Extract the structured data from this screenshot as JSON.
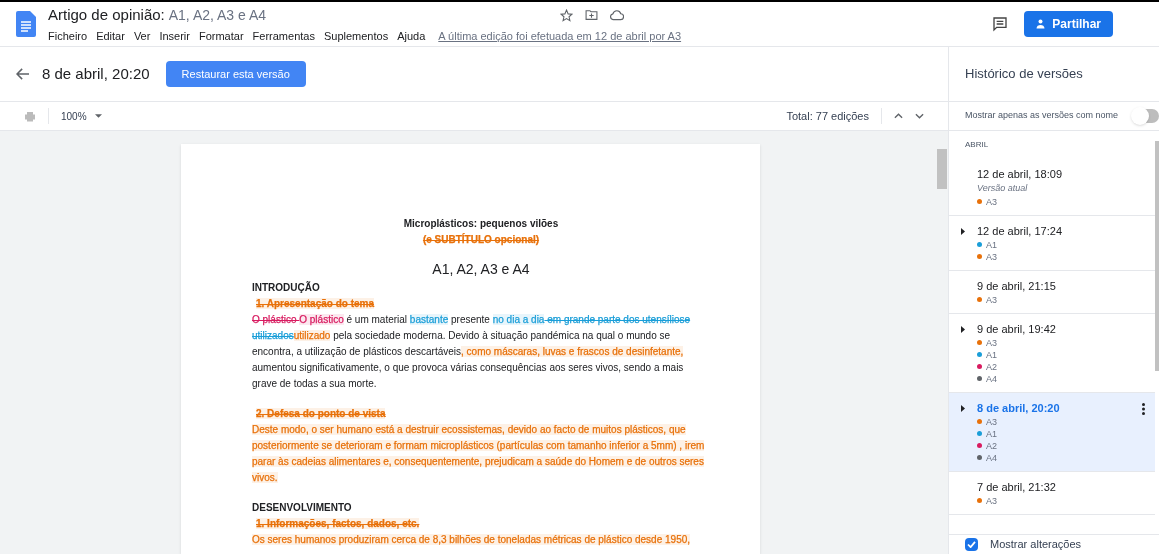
{
  "header": {
    "title": "Artigo de opinião:",
    "title_suffix": "A1, A2, A3  e A4",
    "menu": [
      "Ficheiro",
      "Editar",
      "Ver",
      "Inserir",
      "Formatar",
      "Ferramentas",
      "Suplementos",
      "Ajuda"
    ],
    "last_edit": "A última edição foi efetuada em 12 de abril por A3",
    "share_button": "Partilhar"
  },
  "version_bar": {
    "version": "8 de abril, 20:20",
    "restore_button": "Restaurar esta versão"
  },
  "toolbar": {
    "zoom": "100%",
    "total": "Total: 77 edições"
  },
  "document": {
    "blocks": [
      {
        "kind": "title",
        "segments": [
          {
            "text": "Microplásticos: pequenos vilões",
            "kind": "plain"
          }
        ]
      },
      {
        "kind": "subtitle",
        "segments": [
          {
            "text": "(e SUBTÍTULO opcional)",
            "kind": "delete",
            "color": "#e8710a"
          }
        ]
      },
      {
        "kind": "authors",
        "segments": [
          {
            "text": "A1, A2, A3 e A4",
            "kind": "plain"
          }
        ]
      },
      {
        "kind": "heading",
        "segments": [
          {
            "text": "INTRODUÇÃO",
            "kind": "plain"
          }
        ]
      },
      {
        "kind": "item",
        "segments": [
          {
            "text": "1.   Apresentação do tema",
            "kind": "format",
            "color": "#e8710a"
          }
        ]
      },
      {
        "kind": "paragraph",
        "segments": [
          {
            "text": "O plástico ",
            "kind": "delete",
            "color": "#d81b60"
          },
          {
            "text": "O plástico",
            "kind": "insert",
            "color": "#d81b60"
          },
          {
            "text": " é um material ",
            "kind": "plain"
          },
          {
            "text": "bastante",
            "kind": "insert",
            "color": "#1a9ed8"
          },
          {
            "text": " presente ",
            "kind": "plain"
          },
          {
            "text": "no dia a dia",
            "kind": "insert",
            "color": "#1a9ed8"
          },
          {
            "text": " em grande parte dos utensílios",
            "kind": "delete",
            "color": "#1a9ed8"
          },
          {
            "text": "e utilizados",
            "kind": "delete",
            "color": "#1a9ed8"
          },
          {
            "text": "utilizado",
            "kind": "insert",
            "color": "#e8710a"
          },
          {
            "text": " pela sociedade moderna. Devido à situação pandémica na qual o mundo se encontra, a utilização de plásticos descartáveis",
            "kind": "plain"
          },
          {
            "text": ", como máscaras, luvas e frascos de desinfetante,",
            "kind": "insert",
            "color": "#e8710a"
          },
          {
            "text": " aumentou significativamente, o que provoca várias consequências aos seres vivos, sendo a mais grave de todas a sua morte.",
            "kind": "plain"
          }
        ]
      },
      {
        "kind": "item",
        "segments": [
          {
            "text": "2.   Defesa do ponto de vista",
            "kind": "format",
            "color": "#e8710a"
          }
        ]
      },
      {
        "kind": "paragraph",
        "segments": [
          {
            "text": "Deste modo, o ser humano está a destruir ecossistemas, devido ao facto de muitos plásticos, que posteriormente se deterioram e formam microplásticos (partículas com tamanho inferior a 5mm) , irem parar às cadeias alimentares e, consequentemente, prejudicam a saúde do Homem e de outros seres vivos.",
            "kind": "insert",
            "color": "#e8710a"
          }
        ]
      },
      {
        "kind": "heading",
        "segments": [
          {
            "text": "DESENVOLVIMENTO",
            "kind": "plain"
          }
        ]
      },
      {
        "kind": "item",
        "segments": [
          {
            "text": "1.   Informações, factos, dados, etc.",
            "kind": "format",
            "color": "#e8710a"
          }
        ]
      },
      {
        "kind": "paragraph",
        "segments": [
          {
            "text": "Os seres humanos produziram cerca de 8,3 bilhões de toneladas métricas de plástico desde 1950,",
            "kind": "insert",
            "color": "#e8710a"
          }
        ]
      }
    ]
  },
  "history": {
    "title": "Histórico de versões",
    "named_only": {
      "label": "Mostrar apenas as versões com nome",
      "on": false
    },
    "month": "ABRIL",
    "versions": [
      {
        "date": "12 de abril, 18:09",
        "note": "Versão atual",
        "expandable": false,
        "selected": false,
        "authors": [
          {
            "name": "A3",
            "color": "#e8710a"
          }
        ]
      },
      {
        "date": "12 de abril, 17:24",
        "expandable": true,
        "selected": false,
        "authors": [
          {
            "name": "A1",
            "color": "#1a9ed8"
          },
          {
            "name": "A3",
            "color": "#e8710a"
          }
        ]
      },
      {
        "date": "9 de abril, 21:15",
        "expandable": false,
        "selected": false,
        "authors": [
          {
            "name": "A3",
            "color": "#e8710a"
          }
        ]
      },
      {
        "date": "9 de abril, 19:42",
        "expandable": true,
        "selected": false,
        "authors": [
          {
            "name": "A3",
            "color": "#e8710a"
          },
          {
            "name": "A1",
            "color": "#1a9ed8"
          },
          {
            "name": "A2",
            "color": "#d81b60"
          },
          {
            "name": "A4",
            "color": "#5f6368"
          }
        ]
      },
      {
        "date": "8 de abril, 20:20",
        "expandable": true,
        "selected": true,
        "authors": [
          {
            "name": "A3",
            "color": "#e8710a"
          },
          {
            "name": "A1",
            "color": "#1a9ed8"
          },
          {
            "name": "A2",
            "color": "#d81b60"
          },
          {
            "name": "A4",
            "color": "#5f6368"
          }
        ]
      },
      {
        "date": "7 de abril, 21:32",
        "expandable": false,
        "selected": false,
        "authors": [
          {
            "name": "A3",
            "color": "#e8710a"
          }
        ]
      }
    ],
    "show_changes": {
      "label": "Mostrar alterações",
      "checked": true
    }
  }
}
